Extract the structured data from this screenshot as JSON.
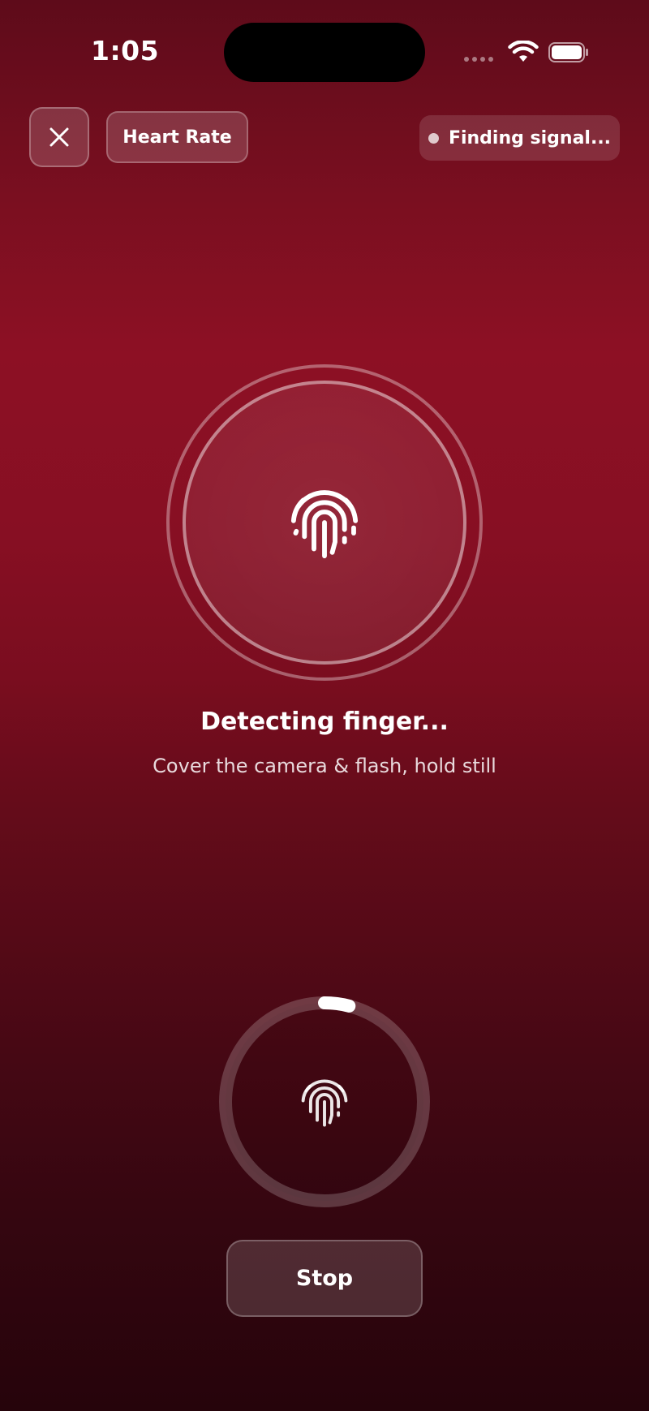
{
  "status_bar": {
    "time": "1:05"
  },
  "header": {
    "title": "Heart Rate",
    "signal_status": "Finding signal..."
  },
  "sensor": {
    "headline": "Detecting finger...",
    "instruction": "Cover the camera & flash, hold still"
  },
  "progress": {
    "fraction": 0.04
  },
  "actions": {
    "stop_label": "Stop"
  },
  "icons": {
    "close": "close-icon",
    "fingerprint": "fingerprint-icon",
    "wifi": "wifi-icon",
    "battery": "battery-icon"
  }
}
